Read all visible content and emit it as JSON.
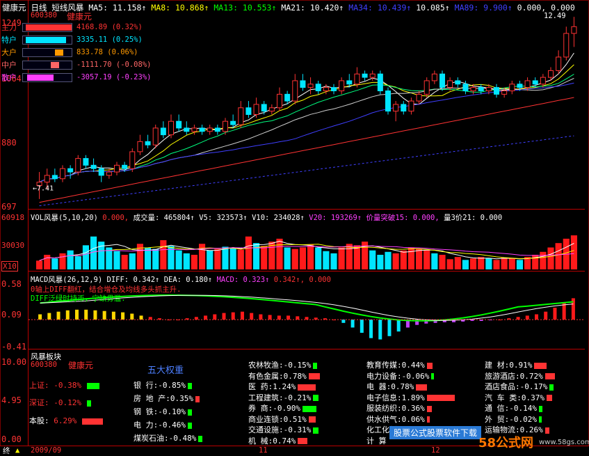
{
  "header": {
    "stock": "健康元",
    "period": "日线",
    "indicator": "短线风暴",
    "ma5": "MA5: 11.158↑",
    "ma8": "MA8: 10.868↑",
    "ma13": "MA13: 10.553↑",
    "ma21": "MA21: 10.420↑",
    "ma34": "MA34: 10.439↑",
    "ma55": "10.085↑",
    "ma89": "MA89: 9.900↑",
    "zero1": "0.000, 0.000",
    "code": "600380",
    "name_red": "健康元",
    "high_label": "12.49"
  },
  "yaxis": {
    "p1": [
      "1249",
      "1064",
      "880",
      "697"
    ],
    "p2": [
      "60918",
      "30030",
      "X10"
    ],
    "p3": [
      "0.58",
      "0.09",
      "-0.41"
    ],
    "p4": [
      "10.00",
      "4.95",
      "0.00"
    ]
  },
  "main_flow": [
    {
      "label": "主力",
      "value": "4168.89 (0.32%)",
      "color": "#ff3333"
    },
    {
      "label": "特户",
      "value": "3335.11 (0.25%)",
      "color": "#00e5ff"
    },
    {
      "label": "大户",
      "value": "833.78 (0.06%)",
      "color": "#ff9900"
    },
    {
      "label": "中户",
      "value": "-1111.70 (-0.08%)",
      "color": "#ff6666"
    },
    {
      "label": "散户",
      "value": "-3057.19 (-0.23%)",
      "color": "#ff40ff"
    }
  ],
  "vol_header": {
    "title": "VOL风暴(5,10,20)",
    "zero": "0.000,",
    "vol": "成交量: 465804↑",
    "v5": "V5: 323573↑",
    "v10": "V10: 234028↑",
    "v20": "V20: 193269↑",
    "break": "价量突破15: 0.000,",
    "q3": "量3价21: 0.000"
  },
  "macd_header": {
    "title": "MACD风暴(26,12,9)",
    "diff": "DIFF: 0.342↑",
    "dea": "DEA: 0.180↑",
    "macd": "MACD: 0.323↑",
    "extra": "0.342↑, 0.000"
  },
  "macd_notes": [
    "0轴上DIFF翻红，结合增仓及均线多头抓主升.",
    "DIFF泛绿时持币，宁缺毋滥."
  ],
  "bottom_panel": {
    "title": "风暴板块",
    "code": "600380",
    "name": "健康元",
    "big5": "五大权重",
    "index_rows": [
      {
        "label": "上证:",
        "value": "-0.38%",
        "color": "#00ff00",
        "frac": 0.6
      },
      {
        "label": "深证:",
        "value": "-0.12%",
        "color": "#00ff00",
        "frac": 0.2
      },
      {
        "label": "本股:",
        "value": "6.29%",
        "color": "#ff3333",
        "frac": 1.0
      }
    ],
    "weights": [
      {
        "name": "银    行:",
        "value": "-0.85%",
        "color": "#00ff00"
      },
      {
        "name": "房 地 产:",
        "value": "0.35%",
        "color": "#ff3333"
      },
      {
        "name": "钢    铁:",
        "value": "-0.10%",
        "color": "#00ff00"
      },
      {
        "name": "电    力:",
        "value": "-0.46%",
        "color": "#00ff00"
      },
      {
        "name": "煤炭石油:",
        "value": "-0.48%",
        "color": "#00ff00"
      }
    ],
    "sectors": [
      [
        {
          "name": "农林牧渔:",
          "value": "-0.15%",
          "color": "#00ff00",
          "frac": 0.15
        },
        {
          "name": "有色金属:",
          "value": "0.78%",
          "color": "#ff3333",
          "frac": 0.4
        },
        {
          "name": "医    药:",
          "value": "1.24%",
          "color": "#ff3333",
          "frac": 0.65
        },
        {
          "name": "工程建筑:",
          "value": "-0.21%",
          "color": "#00ff00",
          "frac": 0.2
        },
        {
          "name": "券    商:",
          "value": "-0.90%",
          "color": "#00ff00",
          "frac": 0.5
        },
        {
          "name": "商业连锁:",
          "value": "0.51%",
          "color": "#ff3333",
          "frac": 0.25
        },
        {
          "name": "交通设施:",
          "value": "-0.31%",
          "color": "#00ff00",
          "frac": 0.2
        },
        {
          "name": "机    械:",
          "value": "0.74%",
          "color": "#ff3333",
          "frac": 0.35
        }
      ],
      [
        {
          "name": "教育传媒:",
          "value": "0.44%",
          "color": "#ff3333",
          "frac": 0.2
        },
        {
          "name": "电力设备:",
          "value": "-0.06%",
          "color": "#00ff00",
          "frac": 0.05
        },
        {
          "name": "电    器:",
          "value": "0.78%",
          "color": "#ff3333",
          "frac": 0.4
        },
        {
          "name": "电子信息:",
          "value": "1.89%",
          "color": "#ff3333",
          "frac": 1.0
        },
        {
          "name": "服装纺织:",
          "value": "0.36%",
          "color": "#ff3333",
          "frac": 0.18
        },
        {
          "name": "供水供气:",
          "value": "0.06%",
          "color": "#ff3333",
          "frac": 0.05
        },
        {
          "name": "化工化纤:",
          "value": "0.71%",
          "color": "#ff3333",
          "frac": 0.35
        },
        {
          "name": "计    算",
          "value": "",
          "color": "#ff3333",
          "frac": 0
        }
      ],
      [
        {
          "name": "建    材:",
          "value": "0.91%",
          "color": "#ff3333",
          "frac": 0.45
        },
        {
          "name": "旅游酒店:",
          "value": "0.72%",
          "color": "#ff3333",
          "frac": 0.35
        },
        {
          "name": "酒店食品:",
          "value": "-0.17%",
          "color": "#00ff00",
          "frac": 0.15
        },
        {
          "name": "汽 车 类:",
          "value": "0.37%",
          "color": "#ff3333",
          "frac": 0.2
        },
        {
          "name": "通    信:",
          "value": "-0.14%",
          "color": "#00ff00",
          "frac": 0.12
        },
        {
          "name": "外    贸:",
          "value": "-0.02%",
          "color": "#00ff00",
          "frac": 0.05
        },
        {
          "name": "运输物流:",
          "value": "0.26%",
          "color": "#ff3333",
          "frac": 0.15
        }
      ]
    ]
  },
  "bottom_bar": {
    "left": "终",
    "d1": "2009/09",
    "d2": "11",
    "d3": "12"
  },
  "watermark": {
    "banner": "股票公式股票软件下载",
    "site": "58公式网",
    "url": "www.58gs.com"
  },
  "chart_data": [
    {
      "type": "candlestick",
      "title": "健康元 日线 短线风暴",
      "ylim": [
        6.97,
        12.49
      ],
      "y_ticks": [
        "12.49",
        "10.64",
        "8.80",
        "6.97"
      ],
      "low_label": "7.41",
      "high_label": "12.49",
      "candles": [
        [
          7.5,
          7.6,
          7.1,
          7.9
        ],
        [
          7.6,
          7.8,
          7.4,
          8.0
        ],
        [
          7.8,
          7.7,
          7.6,
          8.0
        ],
        [
          7.7,
          8.0,
          7.6,
          8.1
        ],
        [
          8.0,
          7.9,
          7.7,
          8.1
        ],
        [
          7.9,
          8.3,
          7.8,
          8.4
        ],
        [
          8.3,
          8.1,
          8.0,
          8.4
        ],
        [
          8.1,
          8.0,
          7.9,
          8.3
        ],
        [
          8.0,
          7.8,
          7.6,
          8.1
        ],
        [
          7.8,
          7.9,
          7.7,
          8.0
        ],
        [
          7.9,
          8.1,
          7.8,
          8.2
        ],
        [
          8.1,
          8.0,
          7.9,
          8.2
        ],
        [
          8.0,
          8.5,
          7.9,
          8.6
        ],
        [
          8.5,
          8.8,
          8.4,
          9.0
        ],
        [
          8.8,
          8.7,
          8.6,
          9.0
        ],
        [
          8.7,
          9.2,
          8.6,
          9.3
        ],
        [
          9.2,
          9.0,
          8.9,
          9.4
        ],
        [
          9.0,
          9.4,
          8.9,
          9.6
        ],
        [
          9.4,
          9.2,
          9.1,
          9.6
        ],
        [
          9.2,
          9.1,
          9.0,
          9.4
        ],
        [
          9.1,
          9.2,
          9.0,
          9.3
        ],
        [
          9.2,
          9.1,
          9.0,
          9.3
        ],
        [
          9.1,
          9.2,
          9.0,
          9.3
        ],
        [
          9.2,
          9.1,
          9.0,
          9.3
        ],
        [
          9.1,
          9.4,
          9.0,
          9.5
        ],
        [
          9.4,
          9.3,
          9.2,
          9.6
        ],
        [
          9.3,
          9.8,
          9.2,
          10.0
        ],
        [
          9.8,
          9.6,
          9.5,
          10.0
        ],
        [
          9.6,
          9.9,
          9.5,
          10.1
        ],
        [
          9.9,
          9.7,
          9.6,
          10.0
        ],
        [
          9.7,
          9.8,
          9.6,
          9.9
        ],
        [
          9.8,
          10.2,
          9.7,
          10.4
        ],
        [
          10.2,
          10.0,
          9.9,
          10.3
        ],
        [
          10.0,
          10.6,
          9.9,
          10.8
        ],
        [
          10.6,
          10.4,
          10.3,
          10.8
        ],
        [
          10.4,
          10.5,
          10.2,
          10.7
        ],
        [
          10.5,
          10.3,
          10.2,
          10.6
        ],
        [
          10.3,
          10.4,
          10.2,
          10.5
        ],
        [
          10.4,
          10.3,
          10.2,
          10.5
        ],
        [
          10.3,
          10.6,
          10.2,
          10.7
        ],
        [
          10.6,
          10.5,
          10.4,
          10.8
        ],
        [
          10.5,
          10.8,
          10.4,
          11.0
        ],
        [
          10.8,
          10.7,
          10.6,
          10.9
        ],
        [
          10.7,
          10.8,
          10.6,
          10.9
        ],
        [
          10.8,
          10.3,
          10.2,
          10.9
        ],
        [
          10.3,
          9.7,
          9.6,
          10.4
        ],
        [
          9.7,
          9.9,
          9.4,
          10.0
        ],
        [
          9.9,
          9.7,
          9.6,
          10.0
        ],
        [
          9.7,
          10.0,
          9.6,
          10.1
        ],
        [
          10.0,
          10.2,
          9.9,
          10.3
        ],
        [
          10.2,
          10.6,
          10.1,
          10.7
        ],
        [
          10.6,
          10.8,
          10.5,
          10.9
        ],
        [
          10.8,
          10.4,
          10.3,
          10.9
        ],
        [
          10.4,
          10.6,
          10.3,
          10.7
        ],
        [
          10.6,
          10.5,
          10.4,
          10.7
        ],
        [
          10.5,
          10.3,
          10.2,
          10.6
        ],
        [
          10.3,
          10.4,
          10.2,
          10.5
        ],
        [
          10.4,
          10.3,
          10.2,
          10.5
        ],
        [
          10.3,
          10.4,
          10.2,
          10.5
        ],
        [
          10.4,
          10.2,
          10.1,
          10.5
        ],
        [
          10.2,
          10.3,
          10.1,
          10.4
        ],
        [
          10.3,
          10.5,
          10.2,
          10.6
        ],
        [
          10.5,
          10.4,
          10.3,
          10.6
        ],
        [
          10.4,
          10.6,
          10.3,
          10.7
        ],
        [
          10.6,
          10.5,
          10.4,
          10.7
        ],
        [
          10.5,
          10.7,
          10.4,
          10.8
        ],
        [
          10.7,
          10.9,
          10.6,
          11.0
        ],
        [
          10.9,
          11.3,
          10.8,
          11.5
        ],
        [
          11.3,
          12.0,
          11.2,
          12.2
        ],
        [
          12.0,
          12.2,
          11.6,
          12.49
        ]
      ]
    },
    {
      "type": "bar",
      "title": "VOL风暴(5,10,20)",
      "ylim": [
        0,
        60918
      ],
      "y_ticks": [
        "60918",
        "30030"
      ],
      "values": [
        12000,
        20000,
        15000,
        22000,
        26000,
        18000,
        33000,
        45000,
        38000,
        30000,
        25000,
        20000,
        22000,
        35000,
        30000,
        28000,
        40000,
        32000,
        26000,
        22000,
        20000,
        35000,
        26000,
        28000,
        31000,
        30000,
        27000,
        45000,
        36000,
        32000,
        38000,
        42000,
        30000,
        28000,
        30000,
        34000,
        30000,
        25000,
        22000,
        30000,
        35000,
        33000,
        38000,
        26000,
        20000,
        24000,
        22000,
        26000,
        30000,
        28000,
        26000,
        22000,
        20000,
        14000,
        17000,
        13000,
        15000,
        17000,
        15000,
        13000,
        16000,
        15000,
        13000,
        17000,
        20000,
        24000,
        30000,
        36000,
        42000,
        46580
      ],
      "colors": [
        "red",
        "red",
        "cyan",
        "red",
        "cyan",
        "cyan",
        "cyan",
        "cyan",
        "cyan",
        "cyan",
        "cyan",
        "red",
        "cyan",
        "red",
        "cyan",
        "cyan",
        "red",
        "cyan",
        "cyan",
        "cyan",
        "red",
        "red",
        "cyan",
        "red",
        "cyan",
        "cyan",
        "red",
        "red",
        "cyan",
        "red",
        "red",
        "red",
        "cyan",
        "red",
        "red",
        "red",
        "cyan",
        "cyan",
        "cyan",
        "red",
        "red",
        "red",
        "red",
        "cyan",
        "cyan",
        "cyan",
        "red",
        "red",
        "red",
        "red",
        "red",
        "cyan",
        "red",
        "red",
        "red",
        "cyan",
        "red",
        "red",
        "cyan",
        "red",
        "red",
        "red",
        "cyan",
        "red",
        "red",
        "red",
        "red",
        "red",
        "red",
        "red"
      ]
    },
    {
      "type": "bar",
      "title": "MACD风暴(26,12,9)",
      "ylim": [
        -0.41,
        0.58
      ],
      "y_ticks": [
        "0.58",
        "0.09",
        "-0.41"
      ],
      "values": [
        0.08,
        0.1,
        0.12,
        0.14,
        0.15,
        0.15,
        0.14,
        0.13,
        0.12,
        0.11,
        0.09,
        0.06,
        0.04,
        0.02,
        0.0,
        0.0,
        0.02,
        0.04,
        0.06,
        0.08,
        0.1,
        0.11,
        0.12,
        0.1,
        0.08,
        0.07,
        0.06,
        0.06,
        0.05,
        0.04,
        0.03,
        0.02,
        0.0,
        -0.05,
        -0.12,
        -0.2,
        -0.28,
        -0.3,
        -0.25,
        -0.18,
        -0.12,
        -0.08,
        -0.06,
        -0.05,
        -0.04,
        -0.04,
        -0.03,
        -0.02,
        -0.02,
        -0.01,
        0.0,
        0.02,
        0.04,
        0.06,
        0.08,
        0.12,
        0.18,
        0.25,
        0.323
      ]
    }
  ]
}
